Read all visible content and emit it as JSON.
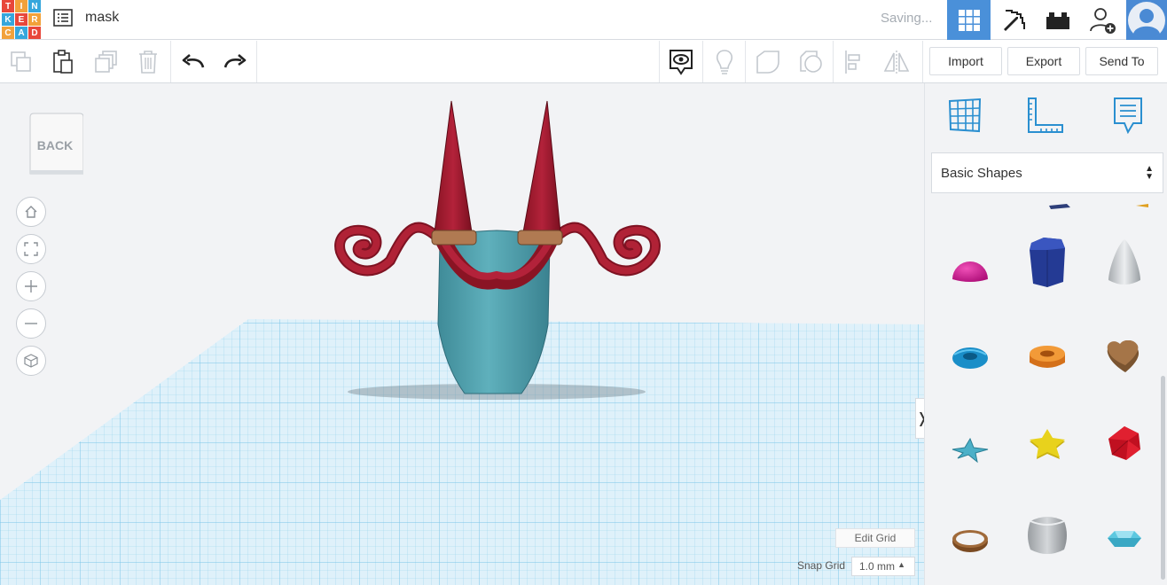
{
  "app": {
    "logo_letters": [
      "T",
      "I",
      "N",
      "K",
      "E",
      "R",
      "C",
      "A",
      "D"
    ],
    "logo_colors": [
      "#e8473b",
      "#f2a13a",
      "#36a6dc",
      "#e8473b",
      "#f2a13a",
      "#36a6dc",
      "#e8473b",
      "#f2a13a",
      "#36a6dc"
    ],
    "design_title": "mask",
    "status": "Saving..."
  },
  "header": {
    "buttons": [
      {
        "name": "3d-design-view",
        "icon": "grid-icon",
        "active": true
      },
      {
        "name": "codeblocks-view",
        "icon": "pickaxe-icon",
        "active": false
      },
      {
        "name": "bricks-view",
        "icon": "bricks-icon",
        "active": false
      },
      {
        "name": "invite-collaborator",
        "icon": "user-plus-icon",
        "active": false
      }
    ],
    "accent_color": "#4a90d9"
  },
  "toolbar": {
    "tools": [
      "copy-icon",
      "paste-icon",
      "duplicate-icon",
      "delete-icon",
      "undo-icon",
      "redo-icon",
      "notes-icon",
      "light-bulb-icon",
      "shape-icon",
      "hole-icon",
      "align-icon",
      "mirror-icon"
    ],
    "import_label": "Import",
    "export_label": "Export",
    "send_to_label": "Send To"
  },
  "viewport": {
    "viewcube_label": "BACK",
    "nav": [
      "home-icon",
      "fit-view-icon",
      "zoom-in-icon",
      "zoom-out-icon",
      "ortho-icon"
    ],
    "edit_grid_label": "Edit Grid",
    "snap_grid_label": "Snap Grid",
    "snap_grid_value": "1.0 mm",
    "collapse_glyph": "❭"
  },
  "panel": {
    "top_icons": [
      "workplane-icon",
      "ruler-icon",
      "notes-icon"
    ],
    "category": "Basic Shapes",
    "shapes": [
      "half-sphere",
      "polygon",
      "paraboloid",
      "torus",
      "tube",
      "heart",
      "star",
      "star-thick",
      "icosahedron",
      "ring",
      "round-roof",
      "gem"
    ]
  }
}
